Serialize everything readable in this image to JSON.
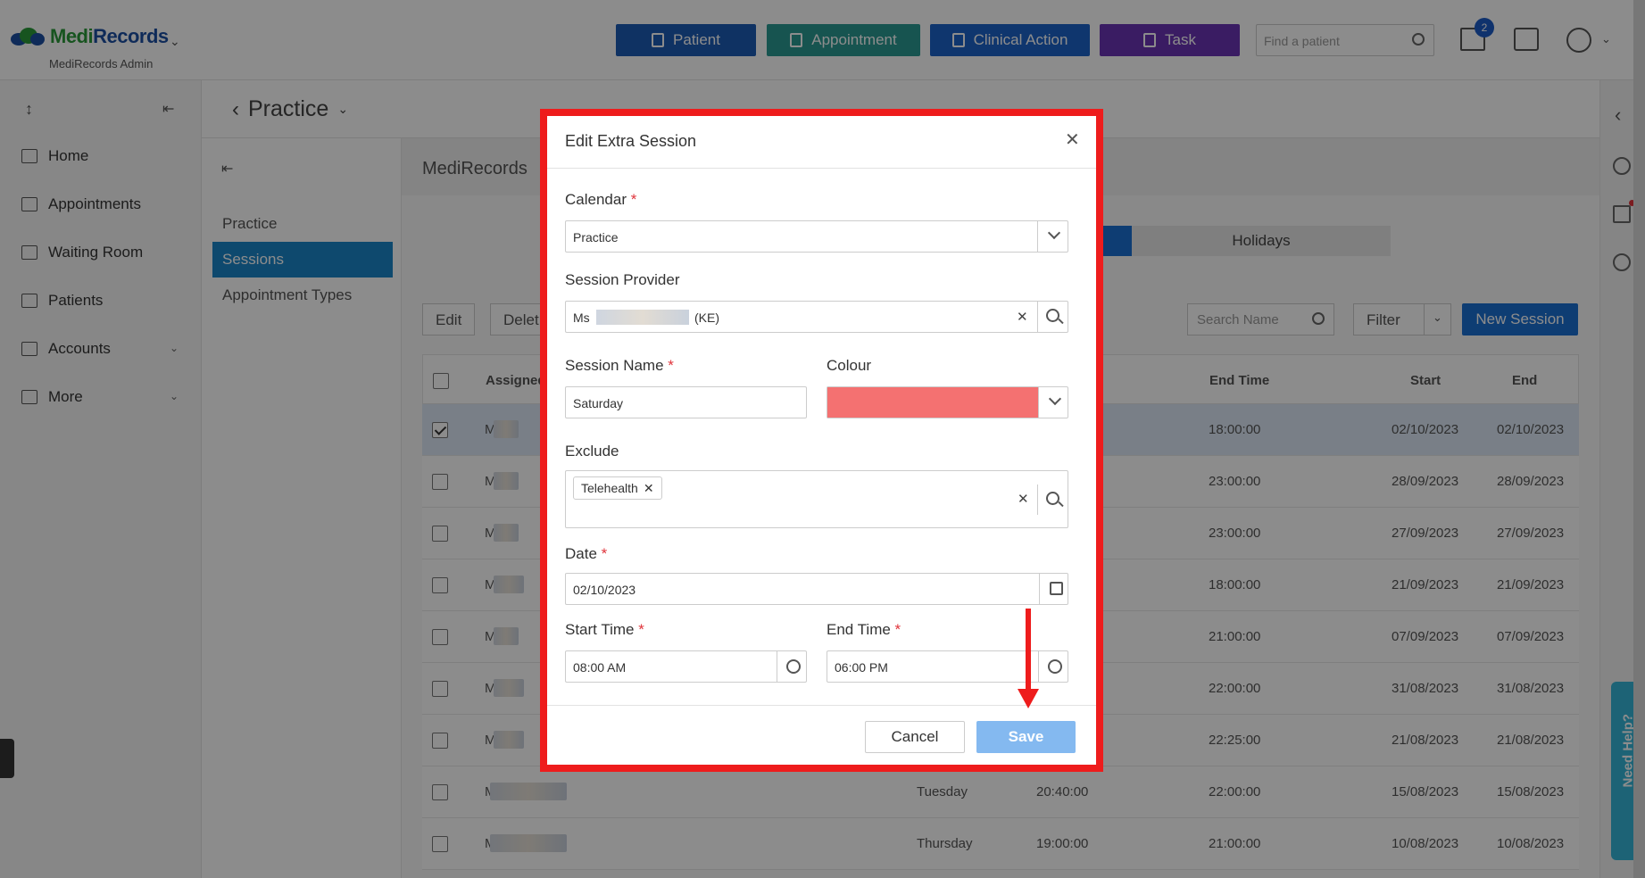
{
  "brand": {
    "name_part1": "Medi",
    "name_part2": "Records",
    "subtitle": "MediRecords Admin"
  },
  "header": {
    "buttons": [
      {
        "label": "Patient",
        "color": "#1d5bb5",
        "icon": "person-plus-icon"
      },
      {
        "label": "Appointment",
        "color": "#2a9a93",
        "icon": "calendar-plus-icon"
      },
      {
        "label": "Clinical Action",
        "color": "#1d63c8",
        "icon": "medical-kit-icon"
      },
      {
        "label": "Task",
        "color": "#6b33b5",
        "icon": "clipboard-check-icon"
      }
    ],
    "search_placeholder": "Find a patient",
    "mail_badge": "2"
  },
  "leftnav": {
    "items": [
      {
        "label": "Home",
        "icon": "home-icon"
      },
      {
        "label": "Appointments",
        "icon": "calendar-icon"
      },
      {
        "label": "Waiting Room",
        "icon": "people-icon"
      },
      {
        "label": "Patients",
        "icon": "patients-icon"
      },
      {
        "label": "Accounts",
        "icon": "folder-icon"
      },
      {
        "label": "More",
        "icon": "folder-plus-icon"
      }
    ]
  },
  "practice": {
    "title": "Practice",
    "banner": "MediRecords",
    "subnav": [
      "Practice",
      "Sessions",
      "Appointment Types"
    ],
    "tab_holidays": "Holidays",
    "btn_edit": "Edit",
    "btn_delete": "Delet",
    "search_name_placeholder": "Search Name",
    "filter_label": "Filter",
    "new_session_label": "New Session"
  },
  "table": {
    "columns": [
      "Assigned",
      "End Time",
      "Start",
      "End"
    ],
    "rows": [
      {
        "prefix": "Ms",
        "day": "",
        "start_time": "",
        "end_time": "18:00:00",
        "start": "02/10/2023",
        "end": "02/10/2023",
        "checked": true
      },
      {
        "prefix": "Mr",
        "day": "",
        "start_time": "",
        "end_time": "23:00:00",
        "start": "28/09/2023",
        "end": "28/09/2023",
        "checked": false
      },
      {
        "prefix": "Mr",
        "day": "",
        "start_time": "",
        "end_time": "23:00:00",
        "start": "27/09/2023",
        "end": "27/09/2023",
        "checked": false
      },
      {
        "prefix": "Mr",
        "day": "",
        "start_time": "",
        "end_time": "18:00:00",
        "start": "21/09/2023",
        "end": "21/09/2023",
        "checked": false
      },
      {
        "prefix": "Mr",
        "day": "",
        "start_time": "",
        "end_time": "21:00:00",
        "start": "07/09/2023",
        "end": "07/09/2023",
        "checked": false
      },
      {
        "prefix": "Mr",
        "day": "",
        "start_time": "",
        "end_time": "22:00:00",
        "start": "31/08/2023",
        "end": "31/08/2023",
        "checked": false
      },
      {
        "prefix": "Mr",
        "day": "",
        "start_time": "",
        "end_time": "22:25:00",
        "start": "21/08/2023",
        "end": "21/08/2023",
        "checked": false
      },
      {
        "prefix": "Mr",
        "day": "Tuesday",
        "start_time": "20:40:00",
        "end_time": "22:00:00",
        "start": "15/08/2023",
        "end": "15/08/2023",
        "checked": false
      },
      {
        "prefix": "Mr",
        "day": "Thursday",
        "start_time": "19:00:00",
        "end_time": "21:00:00",
        "start": "10/08/2023",
        "end": "10/08/2023",
        "checked": false
      }
    ]
  },
  "modal": {
    "title": "Edit Extra Session",
    "calendar_label": "Calendar",
    "calendar_value": "Practice",
    "provider_label": "Session Provider",
    "provider_prefix": "Ms",
    "provider_suffix": "(KE)",
    "session_name_label": "Session Name",
    "session_name_value": "Saturday",
    "colour_label": "Colour",
    "colour_value": "#f47171",
    "exclude_label": "Exclude",
    "exclude_chip": "Telehealth",
    "date_label": "Date",
    "date_value": "02/10/2023",
    "start_time_label": "Start Time",
    "start_time_value": "08:00 AM",
    "end_time_label": "End Time",
    "end_time_value": "06:00 PM",
    "cancel_label": "Cancel",
    "save_label": "Save",
    "required_mark": "*"
  },
  "help": {
    "label": "Need Help?"
  }
}
